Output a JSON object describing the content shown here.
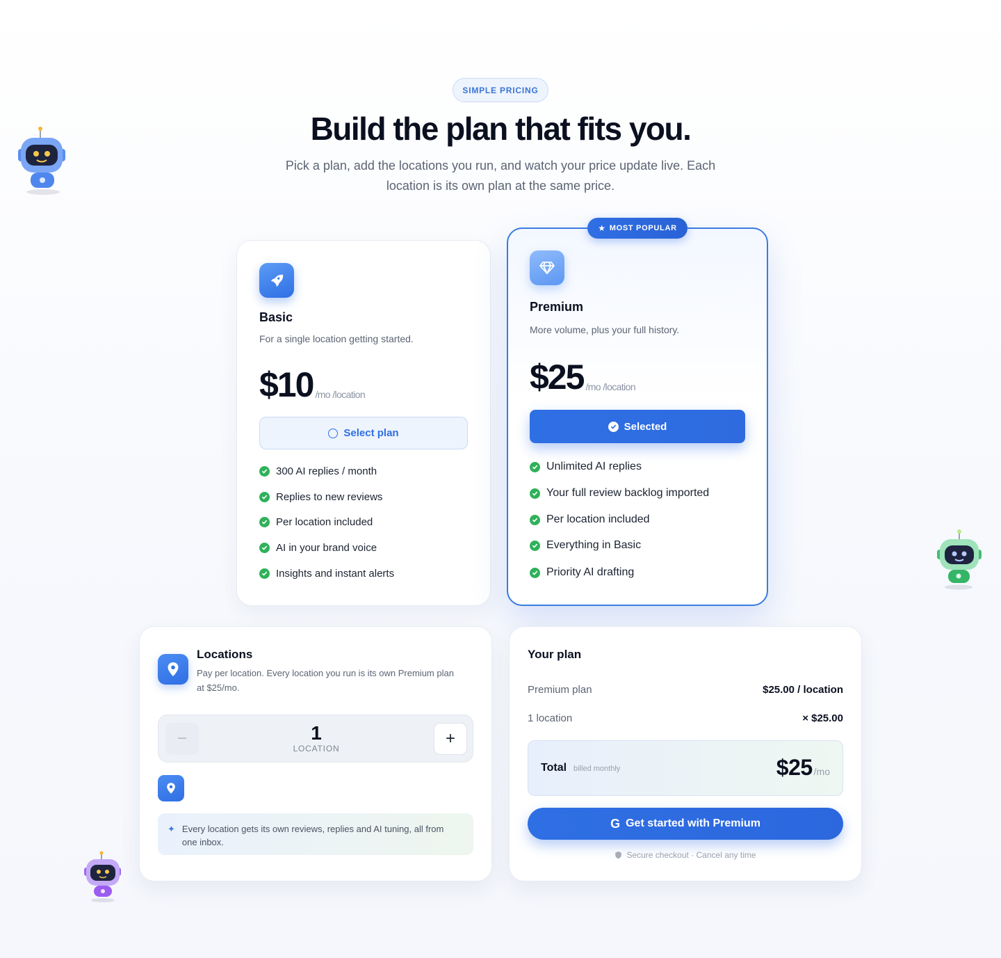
{
  "header": {
    "pill": "SIMPLE PRICING",
    "title": "Build the plan that fits you.",
    "subtitle_line1": "Pick a plan, add the locations you run, and watch your price update live. Each",
    "subtitle_line2": "location is its own plan at the same price."
  },
  "basic": {
    "name": "Basic",
    "description": "For a single location getting started.",
    "price": "$10",
    "per": "/mo /location",
    "button": "Select plan",
    "features": [
      "300 AI replies / month",
      "Replies to new reviews",
      "Per location included",
      "AI in your brand voice",
      "Insights and instant alerts"
    ]
  },
  "premium": {
    "badge": "MOST POPULAR",
    "name": "Premium",
    "description": "More volume, plus your full history.",
    "price": "$25",
    "per": "/mo /location",
    "button": "Selected",
    "features": [
      "Unlimited AI replies",
      "Your full review backlog imported",
      "Per location included",
      "Everything in Basic",
      "Priority AI drafting"
    ]
  },
  "locations": {
    "title": "Locations",
    "description_line1": "Pay per location. Every location you run is its own Premium plan",
    "description_line2": "at $25/mo.",
    "count": "1",
    "count_label": "LOCATION",
    "minus": "−",
    "plus": "+",
    "info_line1": "Every location gets its own reviews, replies and AI tuning, all from",
    "info_line2": "one inbox."
  },
  "summary": {
    "title": "Your plan",
    "plan_label": "Premium plan",
    "plan_value": "$25.00 / location",
    "qty_label": "1 location",
    "qty_value": "× $25.00",
    "total_label": "Total",
    "billed": "billed monthly",
    "total_value": "$25",
    "total_per": "/mo",
    "cta": "Get started with Premium",
    "secure": "Secure checkout · Cancel any time"
  },
  "colors": {
    "accent": "#2f6fe4",
    "success": "#2fb15a",
    "text": "#0b1020",
    "muted": "#5b6473"
  }
}
